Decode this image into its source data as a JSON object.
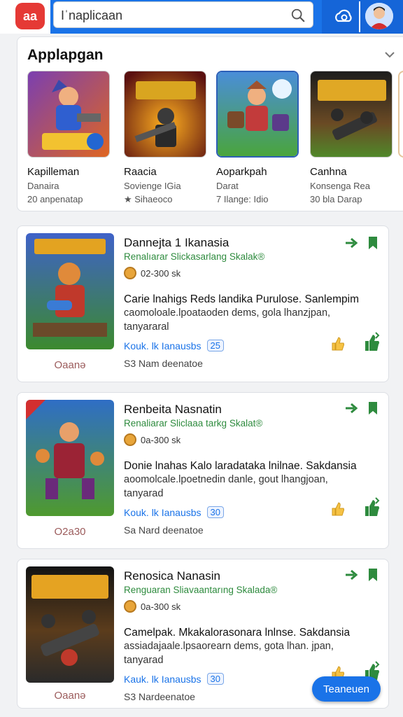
{
  "header": {
    "logo_text": "aa",
    "search_placeholder": "Iˈnaplicaan",
    "accent": "#1a73e8"
  },
  "featured": {
    "title": "Applapgan",
    "apps": [
      {
        "name": "Kapilleman",
        "developer": "Danaira",
        "meta": "20 anpenatap",
        "art": "hero-blue"
      },
      {
        "name": "Raacia",
        "developer": "Sovienge IGia",
        "meta": "★ Sihaeoco",
        "art": "soldier-red"
      },
      {
        "name": "Aoparkpah",
        "developer": "Darat",
        "meta": "7 Ilange: Idio",
        "art": "hero-field"
      },
      {
        "name": "Canhna",
        "developer": "Konsenga Rea",
        "meta": "30 bla Darap",
        "art": "tank-green"
      }
    ]
  },
  "list": [
    {
      "title": "Dannejta 1 Ikanasia",
      "subtitle": "Renalıarar  Slickasarlang Skalak®",
      "meta": "02-300 sk",
      "desc1": "Carie lnahigs Reds landika Purulose. Sanlempim",
      "desc2": "caomoloale.lpoataoden dems, gola lhanzjpan,",
      "desc3": "tanyararal",
      "link": "Kouk. lk Ianausbs",
      "badge": "25",
      "footer": "S3 Nam deenatoe",
      "caption": "Oaanə",
      "art": "hero-blue"
    },
    {
      "title": "Renbeita Nasnatin",
      "subtitle": "Renaliarar  Sliclaaa tarkg Skalat®",
      "meta": "0a-300 sk",
      "desc1": "Donie lnahas Kalo laradataka lnilnae. Sakdansia",
      "desc2": "aoomolcale.lpoetnedin danle, gout lhangjoan,",
      "desc3": "tanyarad",
      "link": "Kouk. lk Ianausbs",
      "badge": "30",
      "footer": "Sa Nard deenatoe",
      "caption": "O2a30",
      "art": "soldier-red"
    },
    {
      "title": "Renosica Nanasin",
      "subtitle": "Renguaran  Sliavaantarıng Skalada®",
      "meta": "0a-300 sk",
      "desc1": "Camelpak. Mkakalorasonara lnlnse. Sakdansia",
      "desc2": "assiadajaale.lpsaorearn dems, gota lhan. jpan,",
      "desc3": "tanyarad",
      "link": "Kauk. lk Ianausbs",
      "badge": "30",
      "footer": "S3 Nardeenatoe",
      "caption": "Oaanə",
      "art": "tank-green"
    }
  ],
  "fab_label": "Teaneuen",
  "colors": {
    "green": "#2e8b3e",
    "blue": "#1a73e8",
    "star": "#f4b400",
    "logo_red": "#e53935"
  }
}
